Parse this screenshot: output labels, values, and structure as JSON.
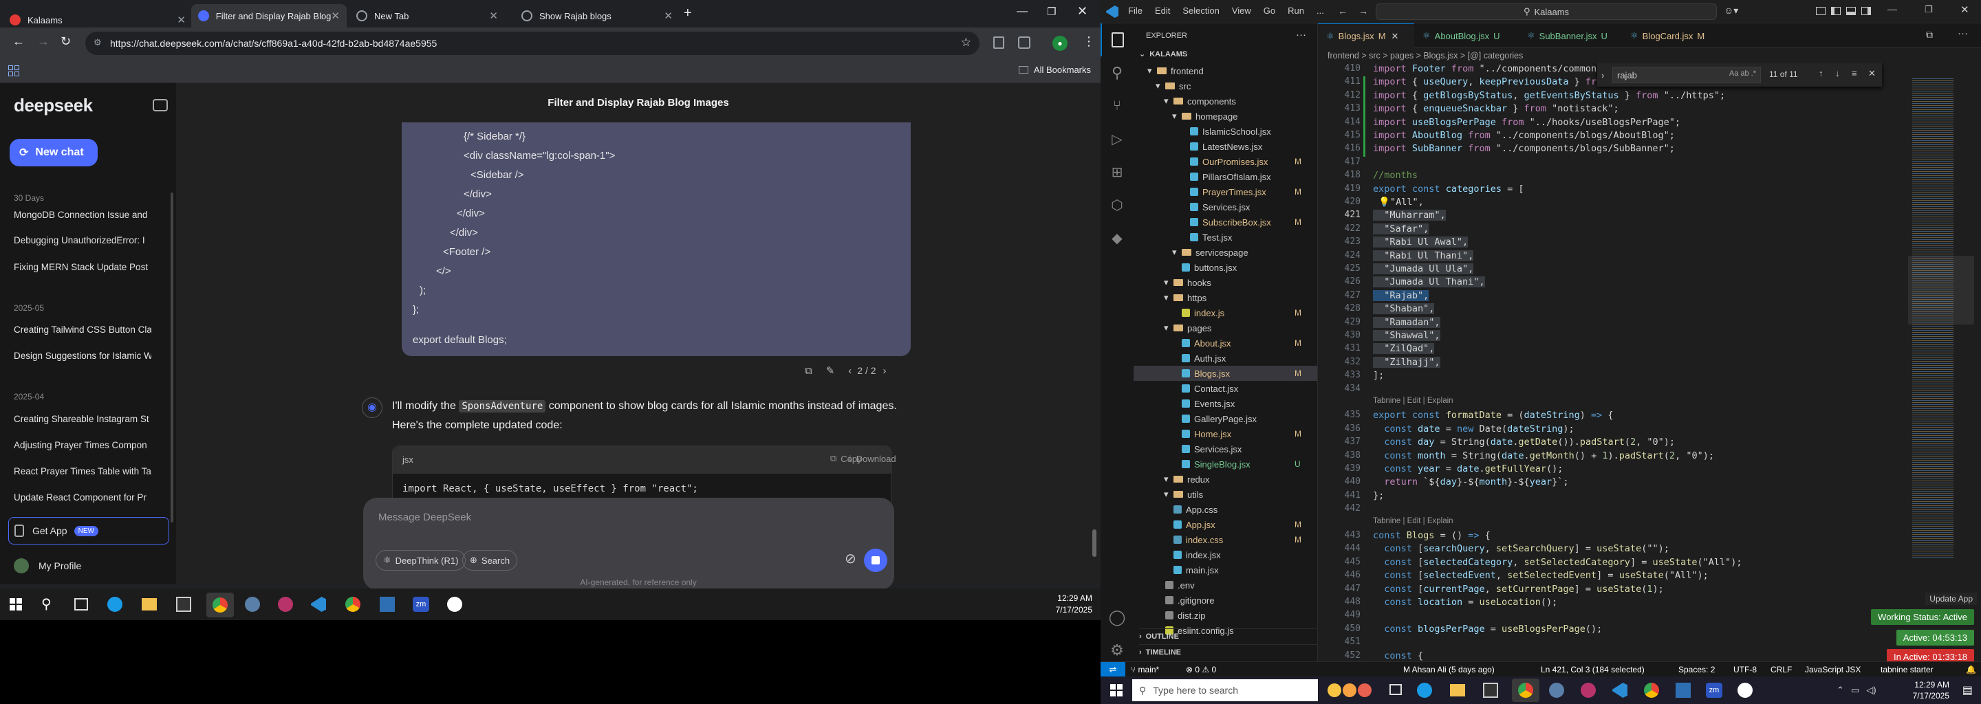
{
  "browser": {
    "tabs": [
      {
        "label": "Kalaams"
      },
      {
        "label": "Filter and Display Rajab Blog In"
      },
      {
        "label": "New Tab"
      },
      {
        "label": "Show Rajab blogs"
      }
    ],
    "url": "https://chat.deepseek.com/a/chat/s/cff869a1-a40d-42fd-b2ab-bd4874ae5955",
    "all_bookmarks": "All Bookmarks",
    "colors": {
      "accent": "#4d6bfe"
    }
  },
  "deepseek": {
    "logo": "deepseek",
    "new_chat": "New chat",
    "chat_title": "Filter and Display Rajab Blog Images",
    "groups": [
      {
        "header": "30 Days",
        "items": [
          "MongoDB Connection Issue and",
          "Debugging UnauthorizedError: I",
          "Fixing MERN Stack Update Post I"
        ]
      },
      {
        "header": "2025-05",
        "items": [
          "Creating Tailwind CSS Button Cla",
          "Design Suggestions for Islamic W"
        ]
      },
      {
        "header": "2025-04",
        "items": [
          "Creating Shareable Instagram St",
          "Adjusting Prayer Times Compon",
          "React Prayer Times Table with Ta",
          "Update React Component for Pr"
        ]
      }
    ],
    "get_app": "Get App",
    "new_badge": "NEW",
    "profile": "My Profile",
    "code_lines": [
      "{/* Sidebar */}",
      "<div className=\"lg:col-span-1\">",
      "<Sidebar />",
      "</div>",
      "</div>",
      "</div>",
      "<Footer />",
      "</>",
      ");",
      "};",
      "",
      "export default Blogs;"
    ],
    "pager": "2 / 2",
    "reply_a": "I'll modify the ",
    "reply_code": "SponsAdventure",
    "reply_b": " component to show blog cards for all Islamic months instead of images.",
    "reply_2": "Here's the complete updated code:",
    "block_lang": "jsx",
    "copy": "Copy",
    "download": "Download",
    "block_first": "import React, { useState, useEffect } from \"react\";",
    "input_placeholder": "Message DeepSeek",
    "deepthink": "DeepThink (R1)",
    "search": "Search",
    "footer_note": "AI-generated, for reference only"
  },
  "taskbar_left": {
    "time": "12:29 AM",
    "date": "7/17/2025"
  },
  "vscode": {
    "menu": [
      "File",
      "Edit",
      "Selection",
      "View",
      "Go",
      "Run",
      "..."
    ],
    "search": "Kalaams",
    "tabs": [
      {
        "label": "Blogs.jsx",
        "status": "M"
      },
      {
        "label": "AboutBlog.jsx",
        "status": "U"
      },
      {
        "label": "SubBanner.jsx",
        "status": "U"
      },
      {
        "label": "BlogCard.jsx",
        "status": "M"
      }
    ],
    "breadcrumb": "frontend > src > pages > Blogs.jsx > [@] categories",
    "explorer_title": "EXPLORER",
    "root": "KALAAMS",
    "find": {
      "query": "rajab",
      "result": "11 of 11"
    },
    "tree": [
      {
        "l": "frontend",
        "d": 1,
        "f": 1,
        "st": ""
      },
      {
        "l": "src",
        "d": 2,
        "f": 1,
        "st": ""
      },
      {
        "l": "components",
        "d": 3,
        "f": 1,
        "st": ""
      },
      {
        "l": "homepage",
        "d": 4,
        "f": 1,
        "st": ""
      },
      {
        "l": "IslamicSchool.jsx",
        "d": 5,
        "f": 0,
        "st": ""
      },
      {
        "l": "LatestNews.jsx",
        "d": 5,
        "f": 0,
        "st": ""
      },
      {
        "l": "OurPromises.jsx",
        "d": 5,
        "f": 0,
        "st": "M"
      },
      {
        "l": "PillarsOfIslam.jsx",
        "d": 5,
        "f": 0,
        "st": ""
      },
      {
        "l": "PrayerTimes.jsx",
        "d": 5,
        "f": 0,
        "st": "M"
      },
      {
        "l": "Services.jsx",
        "d": 5,
        "f": 0,
        "st": ""
      },
      {
        "l": "SubscribeBox.jsx",
        "d": 5,
        "f": 0,
        "st": "M"
      },
      {
        "l": "Test.jsx",
        "d": 5,
        "f": 0,
        "st": ""
      },
      {
        "l": "servicespage",
        "d": 4,
        "f": 1,
        "st": ""
      },
      {
        "l": "buttons.jsx",
        "d": 4,
        "f": 0,
        "st": ""
      },
      {
        "l": "hooks",
        "d": 3,
        "f": 1,
        "st": ""
      },
      {
        "l": "https",
        "d": 3,
        "f": 1,
        "st": ""
      },
      {
        "l": "index.js",
        "d": 4,
        "f": 0,
        "st": "M"
      },
      {
        "l": "pages",
        "d": 3,
        "f": 1,
        "st": ""
      },
      {
        "l": "About.jsx",
        "d": 4,
        "f": 0,
        "st": "M"
      },
      {
        "l": "Auth.jsx",
        "d": 4,
        "f": 0,
        "st": ""
      },
      {
        "l": "Blogs.jsx",
        "d": 4,
        "f": 0,
        "st": "M"
      },
      {
        "l": "Contact.jsx",
        "d": 4,
        "f": 0,
        "st": ""
      },
      {
        "l": "Events.jsx",
        "d": 4,
        "f": 0,
        "st": ""
      },
      {
        "l": "GalleryPage.jsx",
        "d": 4,
        "f": 0,
        "st": ""
      },
      {
        "l": "Home.jsx",
        "d": 4,
        "f": 0,
        "st": "M"
      },
      {
        "l": "Services.jsx",
        "d": 4,
        "f": 0,
        "st": ""
      },
      {
        "l": "SingleBlog.jsx",
        "d": 4,
        "f": 0,
        "st": "U"
      },
      {
        "l": "redux",
        "d": 3,
        "f": 1,
        "st": ""
      },
      {
        "l": "utils",
        "d": 3,
        "f": 1,
        "st": ""
      },
      {
        "l": "App.css",
        "d": 3,
        "f": 0,
        "st": ""
      },
      {
        "l": "App.jsx",
        "d": 3,
        "f": 0,
        "st": "M"
      },
      {
        "l": "index.css",
        "d": 3,
        "f": 0,
        "st": "M"
      },
      {
        "l": "index.jsx",
        "d": 3,
        "f": 0,
        "st": ""
      },
      {
        "l": "main.jsx",
        "d": 3,
        "f": 0,
        "st": ""
      },
      {
        "l": ".env",
        "d": 2,
        "f": 0,
        "st": ""
      },
      {
        "l": ".gitignore",
        "d": 2,
        "f": 0,
        "st": ""
      },
      {
        "l": "dist.zip",
        "d": 2,
        "f": 0,
        "st": ""
      },
      {
        "l": "eslint.config.js",
        "d": 2,
        "f": 0,
        "st": ""
      }
    ],
    "outline": "OUTLINE",
    "timeline": "TIMELINE",
    "codelens": "Tabnine | Edit | Explain",
    "status": {
      "branch": "main*",
      "errors": "0",
      "warnings": "0",
      "blame": "M Ahsan Ali (5 days ago)",
      "pos": "Ln 421, Col 3 (184 selected)",
      "spaces": "Spaces: 2",
      "enc": "UTF-8",
      "eol": "CRLF",
      "lang": "JavaScript JSX",
      "tabnine": "tabnine starter"
    },
    "badges": {
      "update": "Update App",
      "working": "Working Status: Active",
      "active": "Active: 04:53:13",
      "inactive": "In Active: 01:33:18"
    }
  },
  "taskbar_right": {
    "search": "Type here to search",
    "time": "12:29 AM",
    "date": "7/17/2025"
  }
}
